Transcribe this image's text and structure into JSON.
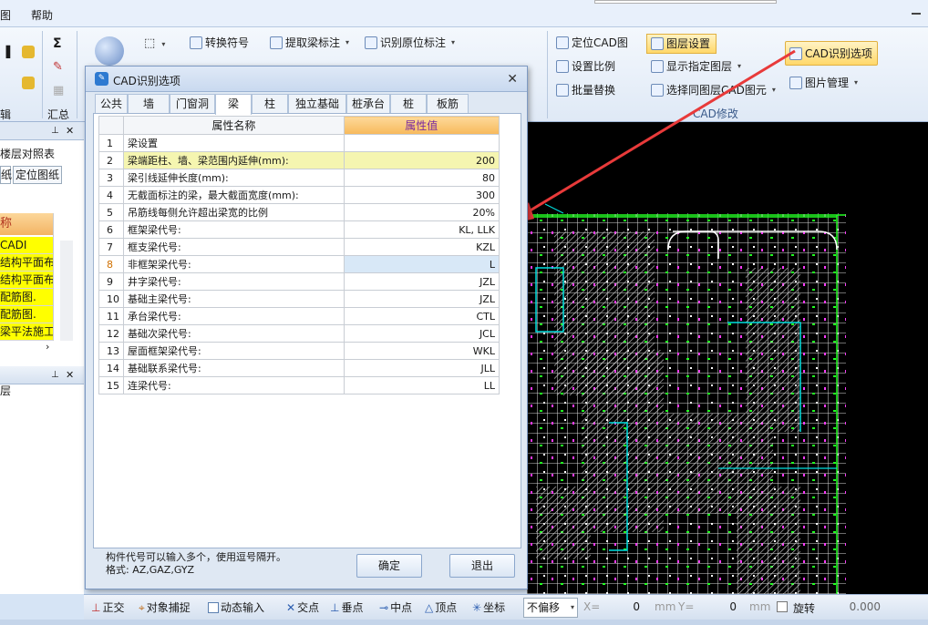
{
  "menubar": {
    "item0": "图",
    "item1": "帮助"
  },
  "ribbon": {
    "convert_symbol": "转换符号",
    "extract_beam_label": "提取梁标注",
    "identify_origin_label": "识别原位标注",
    "locate_cad": "定位CAD图",
    "layer_settings": "图层设置",
    "cad_options": "CAD识别选项",
    "set_scale": "设置比例",
    "show_layer": "显示指定图层",
    "batch_replace": "批量替换",
    "select_same_layer": "选择同图层CAD图元",
    "image_manage": "图片管理",
    "group_label": "CAD修改",
    "sum_label": "汇总",
    "edit_label": "辑"
  },
  "left": {
    "floor_compare": "楼层对照表",
    "paper_tab": "纸",
    "locate_paper": "定位图纸",
    "col_header": "称",
    "rows": [
      "CADI",
      "结构平面布",
      "结构平面布",
      "配筋图.",
      "配筋图.",
      "梁平法施工"
    ],
    "layer_title": "层"
  },
  "dialog": {
    "title": "CAD识别选项",
    "tabs": [
      "公共",
      "墙",
      "门窗洞",
      "梁",
      "柱",
      "独立基础",
      "桩承台",
      "桩",
      "板筋"
    ],
    "active_tab": "梁",
    "header_name": "属性名称",
    "header_value": "属性值",
    "rows": [
      {
        "n": "1",
        "name": "梁设置",
        "value": ""
      },
      {
        "n": "2",
        "name": "梁端距柱、墙、梁范围内延伸(mm):",
        "value": "200"
      },
      {
        "n": "3",
        "name": "梁引线延伸长度(mm):",
        "value": "80"
      },
      {
        "n": "4",
        "name": "无截面标注的梁，最大截面宽度(mm):",
        "value": "300"
      },
      {
        "n": "5",
        "name": "吊筋线每侧允许超出梁宽的比例",
        "value": "20%"
      },
      {
        "n": "6",
        "name": "框架梁代号:",
        "value": "KL, LLK"
      },
      {
        "n": "7",
        "name": "框支梁代号:",
        "value": "KZL"
      },
      {
        "n": "8",
        "name": "非框架梁代号:",
        "value": "L"
      },
      {
        "n": "9",
        "name": "井字梁代号:",
        "value": "JZL"
      },
      {
        "n": "10",
        "name": "基础主梁代号:",
        "value": "JZL"
      },
      {
        "n": "11",
        "name": "承台梁代号:",
        "value": "CTL"
      },
      {
        "n": "12",
        "name": "基础次梁代号:",
        "value": "JCL"
      },
      {
        "n": "13",
        "name": "屋面框架梁代号:",
        "value": "WKL"
      },
      {
        "n": "14",
        "name": "基础联系梁代号:",
        "value": "JLL"
      },
      {
        "n": "15",
        "name": "连梁代号:",
        "value": "LL"
      }
    ],
    "hint_line1": "构件代号可以输入多个，使用逗号隔开。",
    "hint_line2": "格式: AZ,GAZ,GYZ",
    "ok": "确定",
    "exit": "退出"
  },
  "status": {
    "ortho": "正交",
    "snap": "对象捕捉",
    "dynamic": "动态输入",
    "intersect": "交点",
    "perp": "垂点",
    "mid": "中点",
    "vertex": "顶点",
    "coord": "坐标",
    "offset": "不偏移",
    "x_label": "X=",
    "x_value": "0",
    "y_label": "Y=",
    "y_value": "0",
    "unit": "mm",
    "rotate": "旋转",
    "rotate_value": "0.000"
  },
  "colors": {
    "arrow": "#e83a3a",
    "highlight_button": "#ffd86a",
    "cad_bg": "#000000"
  }
}
